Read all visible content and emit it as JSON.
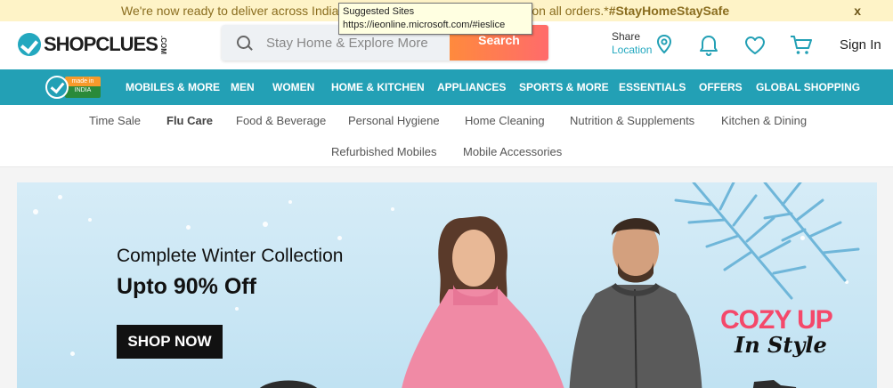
{
  "top_banner": {
    "message": "We're now ready to deliver across India! ",
    "message_tail": "available on all orders.*",
    "hashtag": "#StayHomeStaySafe",
    "close_label": "x"
  },
  "tooltip": {
    "title": "Suggested Sites",
    "url": "https://ieonline.microsoft.com/#ieslice"
  },
  "header": {
    "logo_text": "SHOPCLUES",
    "logo_suffix": ".COM",
    "search": {
      "placeholder": "Stay Home & Explore More",
      "button_label": "Search"
    },
    "share_label": "Share",
    "location_label": "Location",
    "signin_label": "Sign In"
  },
  "nav": {
    "badge_line1": "made in",
    "badge_line2": "INDIA",
    "categories": [
      "MOBILES & MORE",
      "MEN",
      "WOMEN",
      "HOME & KITCHEN",
      "APPLIANCES",
      "SPORTS & MORE",
      "ESSENTIALS",
      "OFFERS",
      "GLOBAL SHOPPING"
    ]
  },
  "subnav": {
    "items": [
      "Time Sale",
      "Flu Care",
      "Food & Beverage",
      "Personal Hygiene",
      "Home Cleaning",
      "Nutrition & Supplements",
      "Kitchen & Dining",
      "Refurbished Mobiles",
      "Mobile Accessories"
    ],
    "active": "Flu Care"
  },
  "hero": {
    "line1": "Complete Winter Collection",
    "line2": "Upto 90% Off",
    "cta": "SHOP NOW",
    "tagline1": "COZY UP",
    "tagline2": "In Style"
  },
  "colors": {
    "teal": "#23a0b5",
    "banner_yellow": "#fef3c7",
    "cta_orange": "#ff7a45"
  }
}
